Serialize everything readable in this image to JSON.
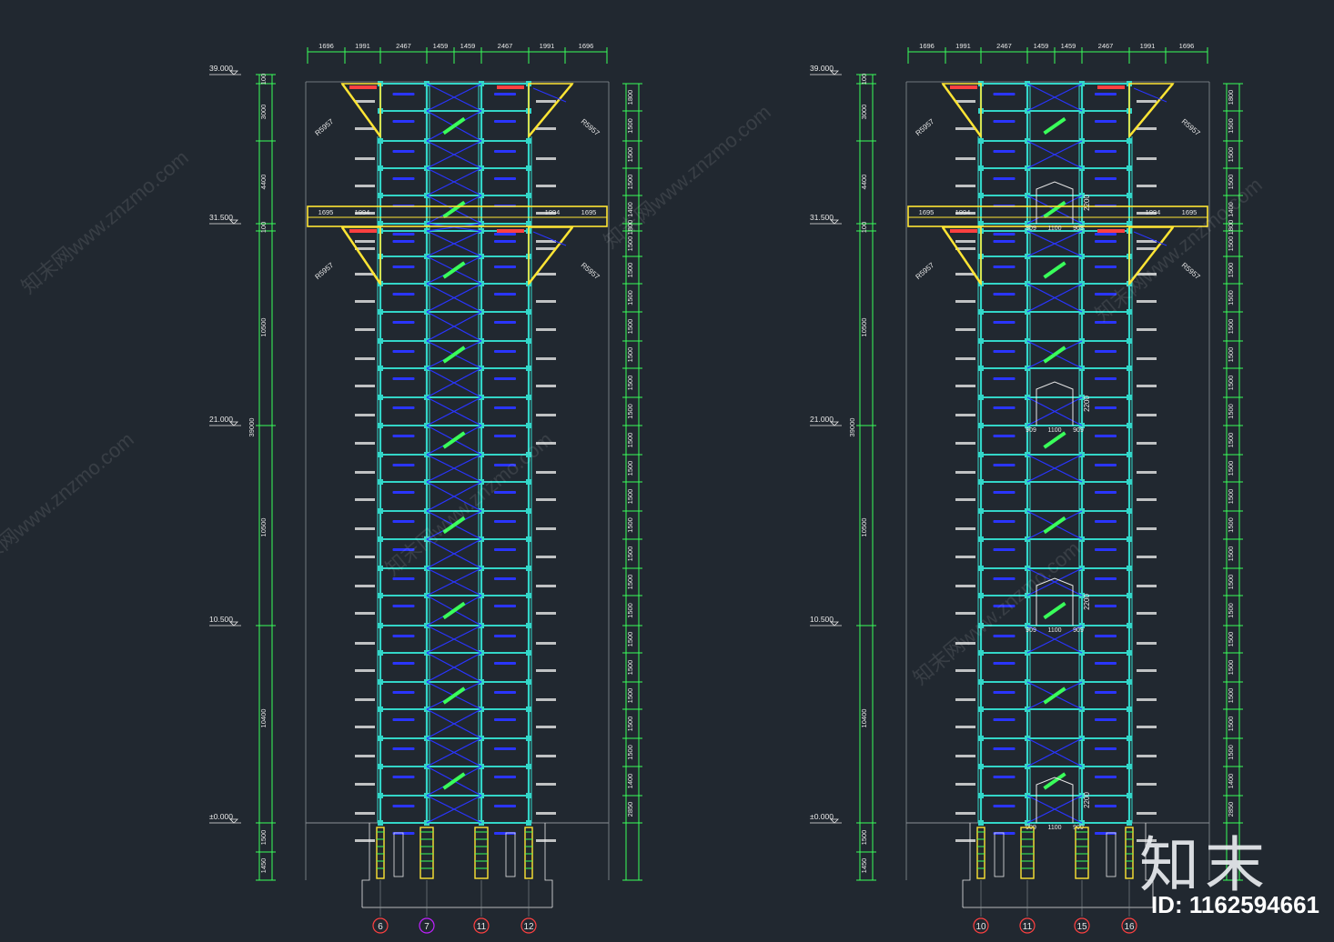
{
  "elevations": [
    "39.000",
    "31.500",
    "21.000",
    "10.500",
    "±0.000"
  ],
  "segments_left": [
    "100",
    "3000",
    "4400",
    "100",
    "10500",
    "39000",
    "10500",
    "10400",
    "1500",
    "1450"
  ],
  "floor_dims": [
    "1800",
    "1500",
    "1500",
    "1500",
    "1400",
    "1800",
    "1500",
    "1500",
    "1500",
    "1500",
    "1500",
    "1500",
    "1500",
    "1500",
    "1500",
    "1500",
    "1500",
    "1500",
    "1500",
    "1500",
    "1500",
    "1500",
    "1500",
    "1500",
    "1500",
    "1400",
    "2850"
  ],
  "top_dims": [
    "1696",
    "1991",
    "2467",
    "1459",
    "1459",
    "2467",
    "1991",
    "1696"
  ],
  "platform_dims": [
    "1695",
    "1994",
    "1994",
    "1695"
  ],
  "brace_label": "R5957",
  "door_dims": [
    "909",
    "1100",
    "909"
  ],
  "door_height": "2200",
  "slope_label": "坡度",
  "drawing1": {
    "axes": [
      "6",
      "7",
      "11",
      "12"
    ]
  },
  "drawing2": {
    "axes": [
      "10",
      "11",
      "15",
      "16"
    ]
  },
  "watermark": "知末网www.znzmo.com",
  "brand": "知末",
  "id_text": "ID: 1162594661",
  "colors": {
    "background": "#212830",
    "column": "#33d6c8",
    "dimension": "#39ff5a",
    "brace": "#2a35ff",
    "yellow": "#ffe534",
    "red": "#ff4040",
    "magenta": "#c020ff",
    "white": "#e8e8e8",
    "grey": "#8a9096"
  }
}
